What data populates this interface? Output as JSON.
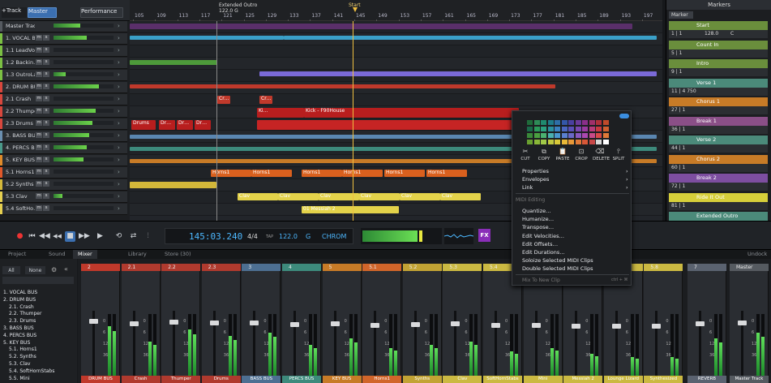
{
  "topbar": {
    "add_track": "+Track",
    "master": "Master",
    "performance": "Performance"
  },
  "ruler": {
    "ticks": [
      "105",
      "109",
      "113",
      "117",
      "121",
      "125",
      "129",
      "133",
      "137",
      "141",
      "145",
      "149",
      "153",
      "157",
      "161",
      "165",
      "169",
      "173",
      "177",
      "181",
      "185",
      "189",
      "193",
      "197"
    ],
    "marker_label": "Extended Outro",
    "tempo_label": "122.0 G",
    "start_label": "Start"
  },
  "tracks": [
    {
      "name": "Master Track",
      "color": "#555a60",
      "level": 0.45
    },
    {
      "name": "1. VOCAL BUS",
      "color": "#7bc043",
      "level": 0.55
    },
    {
      "name": "1.1  LeadVo…",
      "color": "#7bc043",
      "level": 0.0
    },
    {
      "name": "1.2  Backin…",
      "color": "#7bc043",
      "level": 0.0
    },
    {
      "name": "1.3  OutroLala",
      "color": "#7bc043",
      "level": 0.2
    },
    {
      "name": "2. DRUM BUS",
      "color": "#d8473d",
      "level": 0.75
    },
    {
      "name": "2.1  Crash",
      "color": "#d8473d",
      "level": 0.0
    },
    {
      "name": "2.2  Thumper",
      "color": "#d8473d",
      "level": 0.7
    },
    {
      "name": "2.3  Drums",
      "color": "#d8473d",
      "level": 0.65
    },
    {
      "name": "3. BASS BUS",
      "color": "#6b8fb0",
      "level": 0.6
    },
    {
      "name": "4. PERCS BUS",
      "color": "#4a9a8a",
      "level": 0.55
    },
    {
      "name": "5. KEY BUS",
      "color": "#e08b2a",
      "level": 0.5
    },
    {
      "name": "5.1  Horns1",
      "color": "#e0582a",
      "level": 0.0
    },
    {
      "name": "5.2  Synths",
      "color": "#d4b83a",
      "level": 0.0
    },
    {
      "name": "5.3  Clav",
      "color": "#e6d050",
      "level": 0.15
    },
    {
      "name": "5.4  SoftHo…",
      "color": "#e6d050",
      "level": 0.0
    }
  ],
  "clips": {
    "crash1": "Cr…",
    "crash2": "Cr…",
    "kick1": "Ki…",
    "kick2": "Kick - F90House",
    "drums": "Drums",
    "dr": "Dr…",
    "horns": "Horns1",
    "clav": "Clav",
    "messiah": "01 Messiah 2"
  },
  "markers_panel": {
    "title": "Markers",
    "tab": "Marker",
    "items": [
      {
        "name": "Start",
        "num": "1",
        "pos": "1 | 1",
        "tempo": "128.0",
        "key": "C",
        "color": "#6a8e3c"
      },
      {
        "name": "Count In",
        "num": "5",
        "pos": "5 | 1",
        "tempo": "",
        "key": "",
        "color": "#6a8e3c"
      },
      {
        "name": "Intro",
        "num": "9",
        "pos": "9 | 1",
        "tempo": "",
        "key": "",
        "color": "#6a8e3c"
      },
      {
        "name": "Verse 1",
        "num": "11",
        "pos": "11 | 4 750",
        "tempo": "",
        "key": "",
        "color": "#4b8a7a"
      },
      {
        "name": "Chorus 1",
        "num": "27",
        "pos": "27 | 1",
        "tempo": "",
        "key": "",
        "color": "#c77b27"
      },
      {
        "name": "Break 1",
        "num": "36",
        "pos": "36 | 1",
        "tempo": "",
        "key": "",
        "color": "#8a4f87"
      },
      {
        "name": "Verse 2",
        "num": "44",
        "pos": "44 | 1",
        "tempo": "",
        "key": "",
        "color": "#4b8a7a"
      },
      {
        "name": "Chorus 2",
        "num": "60",
        "pos": "60 | 1",
        "tempo": "",
        "key": "",
        "color": "#c77b27"
      },
      {
        "name": "Break 2",
        "num": "72",
        "pos": "72 | 1",
        "tempo": "",
        "key": "",
        "color": "#7d4ea0"
      },
      {
        "name": "Ride It Out",
        "num": "81",
        "pos": "81 | 1",
        "tempo": "",
        "key": "",
        "color": "#d6cf3a"
      },
      {
        "name": "Extended Outro",
        "num": "91",
        "pos": "91 | 4 332",
        "tempo": "",
        "key": "",
        "color": "#4b8a7a"
      }
    ]
  },
  "transport": {
    "time": "145:03.240",
    "signature": "4/4",
    "tempo_label": "TAP",
    "tempo": "122.0",
    "key": "G",
    "scale": "CHROM",
    "fx": "FX"
  },
  "tabs": [
    "Project",
    "Sound",
    "Mixer",
    "Library",
    "Store (30)"
  ],
  "active_tab": "Mixer",
  "undock": "Undock",
  "browser": {
    "all": "All",
    "none": "None",
    "items": [
      "1. VOCAL BUS",
      "2. DRUM BUS",
      "2.1. Crash",
      "2.2. Thumper",
      "2.3. Drums",
      "3. BASS BUS",
      "4. PERCS BUS",
      "5. KEY BUS",
      "5.1. Horns1",
      "5.2. Synths",
      "5.3. Clav",
      "5.4. SoftHornStabs",
      "5.5. Mini"
    ]
  },
  "mixer": {
    "strips": [
      {
        "num": "2",
        "name": "DRUM BUS",
        "color": "#c0392b",
        "level": 0.8
      },
      {
        "num": "2.1",
        "name": "Crash",
        "color": "#b03a2e",
        "level": 0.55
      },
      {
        "num": "2.2",
        "name": "Thumper",
        "color": "#b03a2e",
        "level": 0.75
      },
      {
        "num": "2.3",
        "name": "Drums",
        "color": "#b03a2e",
        "level": 0.65
      },
      {
        "num": "3",
        "name": "BASS BUS",
        "color": "#4d6f92",
        "level": 0.7
      },
      {
        "num": "4",
        "name": "PERCS BUS",
        "color": "#3d8a7c",
        "level": 0.5
      },
      {
        "num": "5",
        "name": "KEY BUS",
        "color": "#c77b27",
        "level": 0.6
      },
      {
        "num": "5.1",
        "name": "Horns1",
        "color": "#d1652a",
        "level": 0.45
      },
      {
        "num": "5.2",
        "name": "Synths",
        "color": "#c2a334",
        "level": 0.5
      },
      {
        "num": "5.3",
        "name": "Clav",
        "color": "#cbb942",
        "level": 0.55
      },
      {
        "num": "5.4",
        "name": "SoftHornStabs",
        "color": "#cbb942",
        "level": 0.4
      },
      {
        "num": "5.5",
        "name": "Mini",
        "color": "#cbb942",
        "level": 0.45
      },
      {
        "num": "5.6",
        "name": "Messiah 2",
        "color": "#cbb942",
        "level": 0.35
      },
      {
        "num": "5.7",
        "name": "Lounge Lizard",
        "color": "#cbb942",
        "level": 0.3
      },
      {
        "num": "5.8",
        "name": "Synthesized",
        "color": "#cbb942",
        "level": 0.3
      },
      {
        "num": "7",
        "name": "REVERB",
        "color": "#5a6270",
        "level": 0.6
      },
      {
        "num": "Master",
        "name": "Master Track",
        "color": "#555a60",
        "level": 0.7
      }
    ],
    "scale": [
      "0",
      "6",
      "12",
      "36"
    ]
  },
  "context_menu": {
    "edit_buttons": [
      "CUT",
      "COPY",
      "PASTE",
      "CROP",
      "DELETE",
      "SPLIT"
    ],
    "items": [
      "Properties",
      "Envelopes",
      "Link"
    ],
    "section": "MIDI Editing",
    "midi_items": [
      "Quantize…",
      "Humanize…",
      "Transpose…",
      "Edit Velocities…",
      "Edit Offsets…",
      "Edit Durations…",
      "Soloize Selected MIDI Clips",
      "Double Selected MIDI Clips"
    ],
    "mix_to_new": "Mix To New Clip",
    "mix_shortcut": "ctrl + ⌘"
  }
}
